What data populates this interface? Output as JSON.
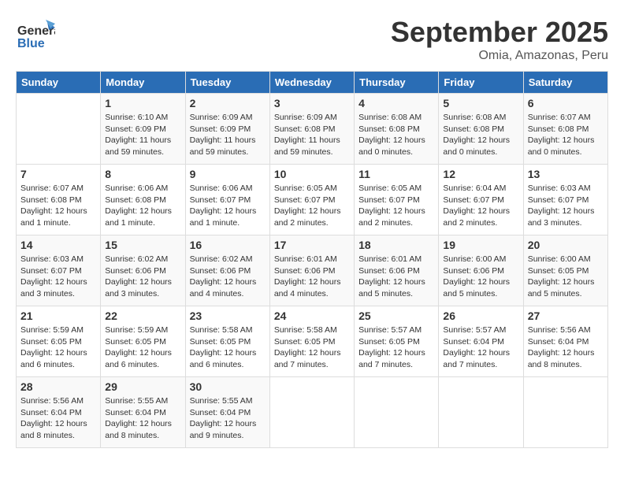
{
  "logo": {
    "general": "General",
    "blue": "Blue"
  },
  "header": {
    "month": "September 2025",
    "location": "Omia, Amazonas, Peru"
  },
  "weekdays": [
    "Sunday",
    "Monday",
    "Tuesday",
    "Wednesday",
    "Thursday",
    "Friday",
    "Saturday"
  ],
  "weeks": [
    [
      {
        "day": "",
        "info": ""
      },
      {
        "day": "1",
        "info": "Sunrise: 6:10 AM\nSunset: 6:09 PM\nDaylight: 11 hours\nand 59 minutes."
      },
      {
        "day": "2",
        "info": "Sunrise: 6:09 AM\nSunset: 6:09 PM\nDaylight: 11 hours\nand 59 minutes."
      },
      {
        "day": "3",
        "info": "Sunrise: 6:09 AM\nSunset: 6:08 PM\nDaylight: 11 hours\nand 59 minutes."
      },
      {
        "day": "4",
        "info": "Sunrise: 6:08 AM\nSunset: 6:08 PM\nDaylight: 12 hours\nand 0 minutes."
      },
      {
        "day": "5",
        "info": "Sunrise: 6:08 AM\nSunset: 6:08 PM\nDaylight: 12 hours\nand 0 minutes."
      },
      {
        "day": "6",
        "info": "Sunrise: 6:07 AM\nSunset: 6:08 PM\nDaylight: 12 hours\nand 0 minutes."
      }
    ],
    [
      {
        "day": "7",
        "info": "Sunrise: 6:07 AM\nSunset: 6:08 PM\nDaylight: 12 hours\nand 1 minute."
      },
      {
        "day": "8",
        "info": "Sunrise: 6:06 AM\nSunset: 6:08 PM\nDaylight: 12 hours\nand 1 minute."
      },
      {
        "day": "9",
        "info": "Sunrise: 6:06 AM\nSunset: 6:07 PM\nDaylight: 12 hours\nand 1 minute."
      },
      {
        "day": "10",
        "info": "Sunrise: 6:05 AM\nSunset: 6:07 PM\nDaylight: 12 hours\nand 2 minutes."
      },
      {
        "day": "11",
        "info": "Sunrise: 6:05 AM\nSunset: 6:07 PM\nDaylight: 12 hours\nand 2 minutes."
      },
      {
        "day": "12",
        "info": "Sunrise: 6:04 AM\nSunset: 6:07 PM\nDaylight: 12 hours\nand 2 minutes."
      },
      {
        "day": "13",
        "info": "Sunrise: 6:03 AM\nSunset: 6:07 PM\nDaylight: 12 hours\nand 3 minutes."
      }
    ],
    [
      {
        "day": "14",
        "info": "Sunrise: 6:03 AM\nSunset: 6:07 PM\nDaylight: 12 hours\nand 3 minutes."
      },
      {
        "day": "15",
        "info": "Sunrise: 6:02 AM\nSunset: 6:06 PM\nDaylight: 12 hours\nand 3 minutes."
      },
      {
        "day": "16",
        "info": "Sunrise: 6:02 AM\nSunset: 6:06 PM\nDaylight: 12 hours\nand 4 minutes."
      },
      {
        "day": "17",
        "info": "Sunrise: 6:01 AM\nSunset: 6:06 PM\nDaylight: 12 hours\nand 4 minutes."
      },
      {
        "day": "18",
        "info": "Sunrise: 6:01 AM\nSunset: 6:06 PM\nDaylight: 12 hours\nand 5 minutes."
      },
      {
        "day": "19",
        "info": "Sunrise: 6:00 AM\nSunset: 6:06 PM\nDaylight: 12 hours\nand 5 minutes."
      },
      {
        "day": "20",
        "info": "Sunrise: 6:00 AM\nSunset: 6:05 PM\nDaylight: 12 hours\nand 5 minutes."
      }
    ],
    [
      {
        "day": "21",
        "info": "Sunrise: 5:59 AM\nSunset: 6:05 PM\nDaylight: 12 hours\nand 6 minutes."
      },
      {
        "day": "22",
        "info": "Sunrise: 5:59 AM\nSunset: 6:05 PM\nDaylight: 12 hours\nand 6 minutes."
      },
      {
        "day": "23",
        "info": "Sunrise: 5:58 AM\nSunset: 6:05 PM\nDaylight: 12 hours\nand 6 minutes."
      },
      {
        "day": "24",
        "info": "Sunrise: 5:58 AM\nSunset: 6:05 PM\nDaylight: 12 hours\nand 7 minutes."
      },
      {
        "day": "25",
        "info": "Sunrise: 5:57 AM\nSunset: 6:05 PM\nDaylight: 12 hours\nand 7 minutes."
      },
      {
        "day": "26",
        "info": "Sunrise: 5:57 AM\nSunset: 6:04 PM\nDaylight: 12 hours\nand 7 minutes."
      },
      {
        "day": "27",
        "info": "Sunrise: 5:56 AM\nSunset: 6:04 PM\nDaylight: 12 hours\nand 8 minutes."
      }
    ],
    [
      {
        "day": "28",
        "info": "Sunrise: 5:56 AM\nSunset: 6:04 PM\nDaylight: 12 hours\nand 8 minutes."
      },
      {
        "day": "29",
        "info": "Sunrise: 5:55 AM\nSunset: 6:04 PM\nDaylight: 12 hours\nand 8 minutes."
      },
      {
        "day": "30",
        "info": "Sunrise: 5:55 AM\nSunset: 6:04 PM\nDaylight: 12 hours\nand 9 minutes."
      },
      {
        "day": "",
        "info": ""
      },
      {
        "day": "",
        "info": ""
      },
      {
        "day": "",
        "info": ""
      },
      {
        "day": "",
        "info": ""
      }
    ]
  ]
}
